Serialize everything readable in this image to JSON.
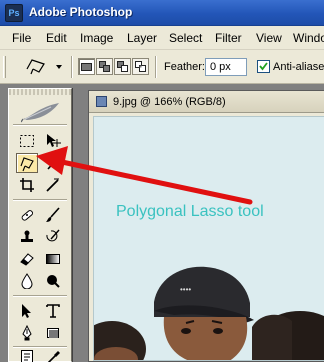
{
  "app": {
    "title": "Adobe Photoshop",
    "icon_label": "Ps"
  },
  "menu": {
    "items": [
      "File",
      "Edit",
      "Image",
      "Layer",
      "Select",
      "Filter",
      "View",
      "Windo"
    ]
  },
  "options": {
    "feather_label": "Feather:",
    "feather_value": "0 px",
    "anti_aliased_label": "Anti-aliased",
    "anti_aliased_checked": true,
    "selection_mode": "new-selection"
  },
  "toolbox": {
    "selected_tool": "polygonal-lasso-tool",
    "tools": [
      "rectangular-marquee-tool",
      "move-tool",
      "polygonal-lasso-tool",
      "magic-wand-tool",
      "crop-tool",
      "slice-tool",
      "healing-brush-tool",
      "brush-tool",
      "clone-stamp-tool",
      "history-brush-tool",
      "eraser-tool",
      "gradient-tool",
      "blur-tool",
      "burn-tool",
      "path-selection-tool",
      "type-tool",
      "pen-tool",
      "shape-tool",
      "notes-tool",
      "eyedropper-tool"
    ]
  },
  "document": {
    "title": "9.jpg @ 166% (RGB/8)",
    "annotation": "Polygonal Lasso tool"
  },
  "colors": {
    "annotation_text": "#3ac2c0",
    "arrow": "#e01010",
    "title_bar": "#2356b8",
    "panel_bg": "#ece9d8",
    "canvas_bg": "#dcecef",
    "selected_tool_bg": "#fbe9a7"
  }
}
